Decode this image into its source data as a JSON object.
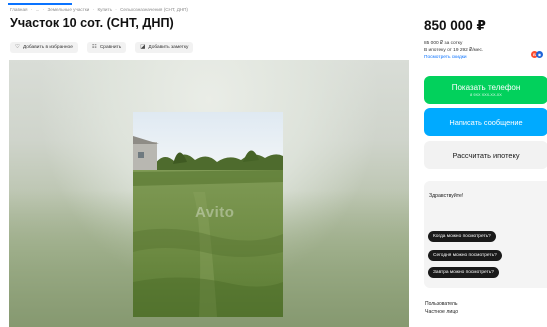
{
  "breadcrumb": [
    "Главная",
    "·",
    "...",
    "·",
    "Земельные участки",
    "·",
    "Купить",
    "·",
    "Сельхозназначения (СНТ, ДНП)"
  ],
  "title": "Участок 10 сот. (СНТ, ДНП)",
  "actions": {
    "favorite": "Добавить в избранное",
    "compare": "Сравнить",
    "note": "Добавить заметку"
  },
  "icons": {
    "favorite": "heart-icon",
    "compare": "compare-icon",
    "note": "note-icon"
  },
  "gallery": {
    "watermark": "Avito"
  },
  "price": {
    "value": "850 000 ₽",
    "per_unit": "85 000 ₽ за сотку",
    "mortgage": "В ипотеку от 19 292 ₽/мес.",
    "offers_link": "Посмотреть скидки"
  },
  "buttons": {
    "phone": "Показать телефон",
    "phone_sub": "8 9XX XXX-XX-XX",
    "message": "Написать сообщение",
    "mortgage": "Рассчитать ипотеку"
  },
  "chat": {
    "greeting": "Здравствуйте!",
    "quick_replies": [
      "Когда можно посмотреть?",
      "Сегодня можно посмотреть?",
      "Завтра можно посмотреть?"
    ]
  },
  "seller": {
    "label": "Пользователь",
    "type": "Частное лицо"
  },
  "colors": {
    "accent": "#0a73ff",
    "phone_button": "#02d15c",
    "message_button": "#00aaff",
    "chip": "#1a1a1a"
  }
}
